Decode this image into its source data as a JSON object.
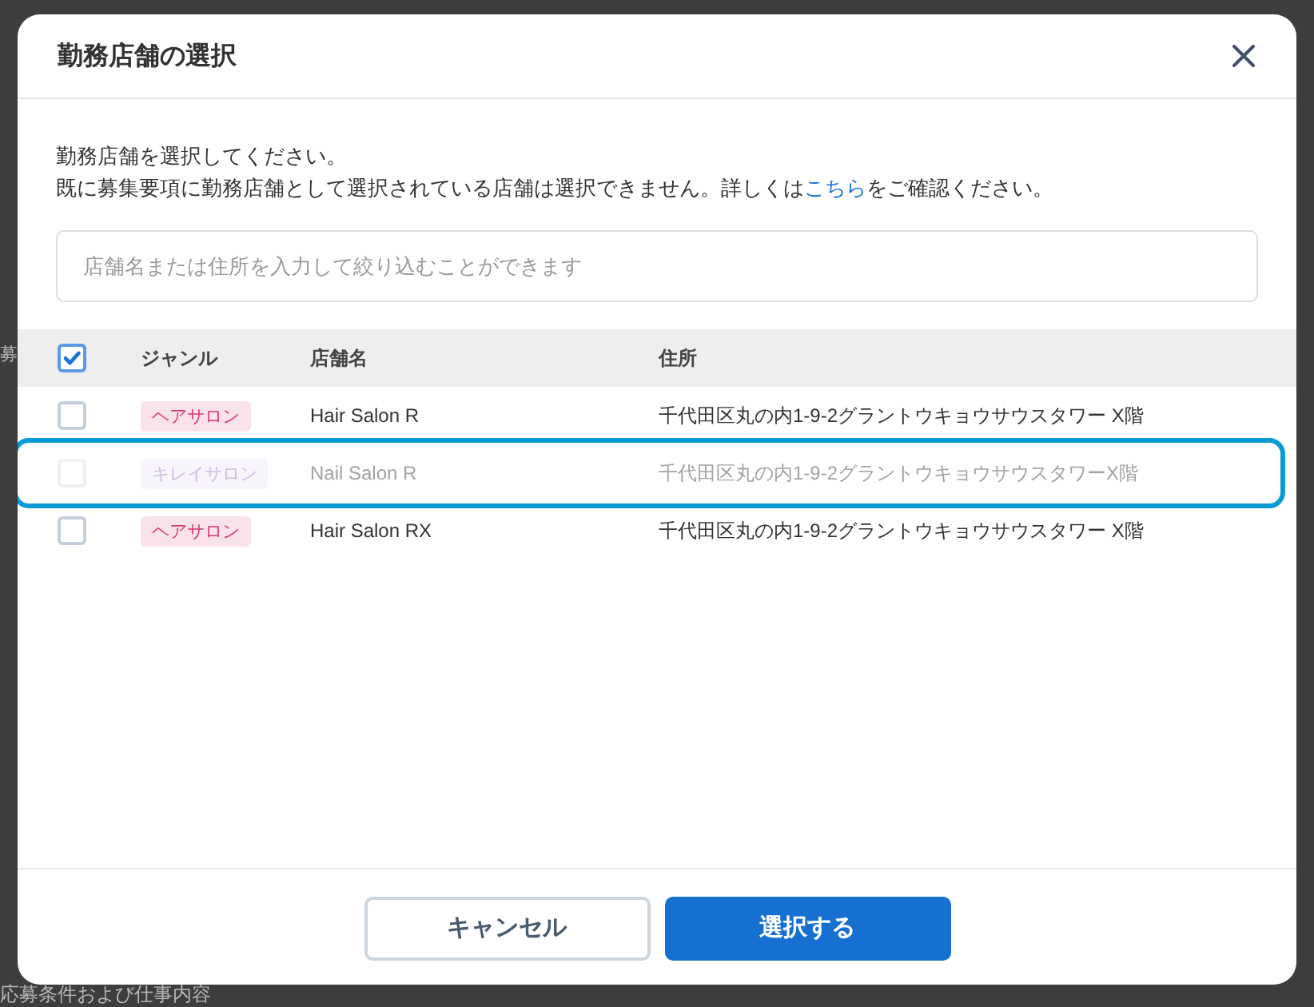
{
  "background": {
    "side_heading": "募",
    "section_heading": "応募条件および仕事内容"
  },
  "dialog": {
    "title": "勤務店舗の選択",
    "intro": "勤務店舗を選択してください。",
    "notice": {
      "before": "既に募集要項に勤務店舗として選択されている店舗は選択できません。詳しくは",
      "link": "こちら",
      "after": "をご確認ください。"
    },
    "search": {
      "placeholder": "店舗名または住所を入力して絞り込むことができます"
    },
    "table": {
      "select_all": {
        "checked": true
      },
      "columns": [
        {
          "label": "ジャンル"
        },
        {
          "label": "店舗名"
        },
        {
          "label": "住所"
        }
      ],
      "rows": [
        {
          "checked": false,
          "disabled": false,
          "highlighted": false,
          "genre": "ヘアサロン",
          "color": "#d43d6b",
          "name": "Hair Salon R",
          "address": "千代田区丸の内1-9-2グラントウキョウサウスタワー X階"
        },
        {
          "checked": false,
          "disabled": true,
          "highlighted": true,
          "genre": "キレイサロン",
          "color": "#cbbde6",
          "name": "Nail Salon R",
          "address": "千代田区丸の内1-9-2グラントウキョウサウスタワーX階"
        },
        {
          "checked": false,
          "disabled": false,
          "highlighted": false,
          "genre": "ヘアサロン",
          "color": "#d43d6b",
          "name": "Hair Salon RX",
          "address": "千代田区丸の内1-9-2グラントウキョウサウスタワー X階"
        }
      ]
    },
    "buttons": [
      {
        "kind": "secondary",
        "label": "キャンセル"
      },
      {
        "kind": "primary",
        "label": "選択する"
      }
    ]
  }
}
